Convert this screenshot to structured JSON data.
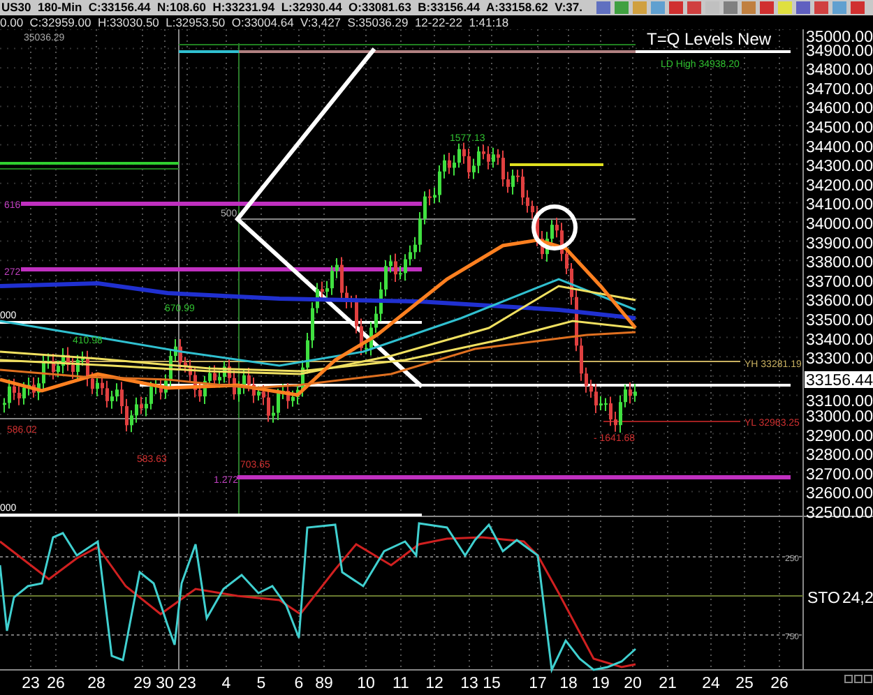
{
  "header": {
    "line_1": "US30  180-Min  C:33156.44  N:108.60  H:33231.94  L:32930.44  O:33081.63  B:33156.44  A:33158.62  V:37.",
    "line_2": "0.00  C:32959.00  H:33030.50  L:32953.50  O:33004.64  V:3,427  S:35036.29  12-22-22  1:41:18"
  },
  "chart": {
    "title": "T=Q Levels New",
    "top_label": "35036.29",
    "level_labels": [
      {
        "text": "616",
        "kind": "fib"
      },
      {
        "text": "500",
        "kind": "plain"
      },
      {
        "text": "272",
        "kind": "fib"
      },
      {
        "text": "410.98",
        "kind": "high"
      },
      {
        "text": "670.99",
        "kind": "high"
      },
      {
        "text": "000",
        "kind": "level"
      },
      {
        "text": "586.02",
        "kind": "low"
      },
      {
        "text": "583.63",
        "kind": "low"
      },
      {
        "text": "703.65",
        "kind": "low"
      },
      {
        "text": "1.272",
        "kind": "fib"
      },
      {
        "text": "000",
        "kind": "level"
      },
      {
        "text": "1577.13",
        "kind": "high"
      },
      {
        "text": "- 1641.68",
        "kind": "low"
      },
      {
        "text": "YH 33281.19",
        "kind": "yh"
      },
      {
        "text": "YL 32963.25",
        "kind": "low"
      },
      {
        "text": "LD High 34938.20",
        "kind": "high"
      }
    ],
    "price_axis": [
      "35000.00",
      "34900.00",
      "34800.00",
      "34700.00",
      "34600.00",
      "34500.00",
      "34400.00",
      "34300.00",
      "34200.00",
      "34100.00",
      "34000.00",
      "33900.00",
      "33800.00",
      "33700.00",
      "33600.00",
      "33500.00",
      "33400.00",
      "33300.00",
      "33100.00",
      "33000.00",
      "32900.00",
      "32800.00",
      "32700.00",
      "32600.00",
      "32500.00"
    ],
    "current_price": "33156.44"
  },
  "stochastic": {
    "name": "STO",
    "value": "24,2",
    "levels": [
      "250",
      "750"
    ]
  },
  "dates": [
    "23",
    "26",
    "28",
    "29",
    "30",
    "23",
    "4",
    "5",
    "6",
    "89",
    "10",
    "11",
    "12",
    "13",
    "15",
    "17",
    "18",
    "19",
    "20",
    "21",
    "24",
    "25",
    "26"
  ]
}
